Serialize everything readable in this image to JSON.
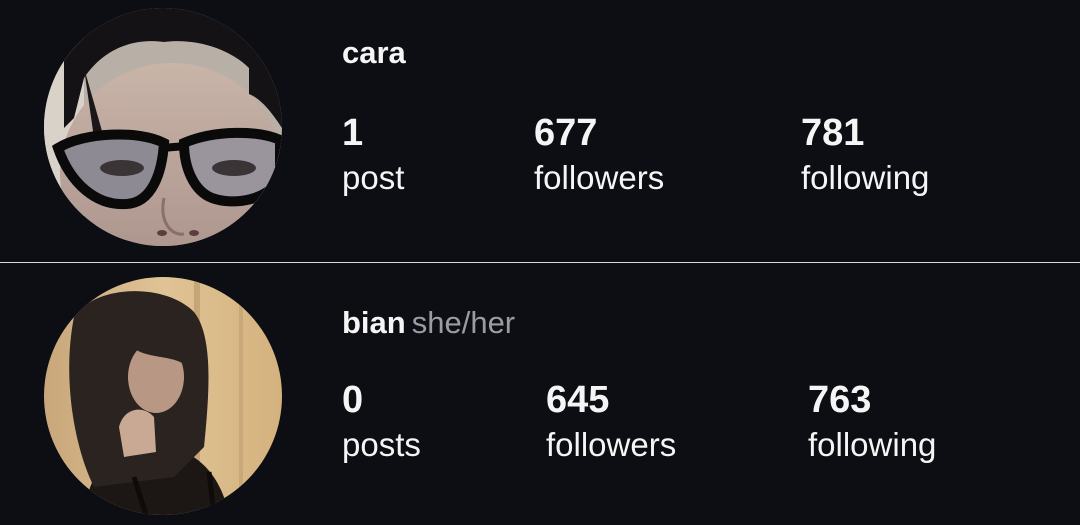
{
  "profiles": [
    {
      "username": "cara",
      "pronouns": "",
      "avatar_icon": "profile-photo-glasses",
      "stats": {
        "posts_value": "1",
        "posts_label": "post",
        "followers_value": "677",
        "followers_label": "followers",
        "following_value": "781",
        "following_label": "following"
      }
    },
    {
      "username": "bian",
      "pronouns": "she/her",
      "avatar_icon": "profile-photo-long-hair",
      "stats": {
        "posts_value": "0",
        "posts_label": "posts",
        "followers_value": "645",
        "followers_label": "followers",
        "following_value": "763",
        "following_label": "following"
      }
    }
  ],
  "colors": {
    "background": "#0c0e13",
    "text": "#f5f5f5",
    "pronouns": "#9a9ca3",
    "divider": "#d9d9d9"
  }
}
